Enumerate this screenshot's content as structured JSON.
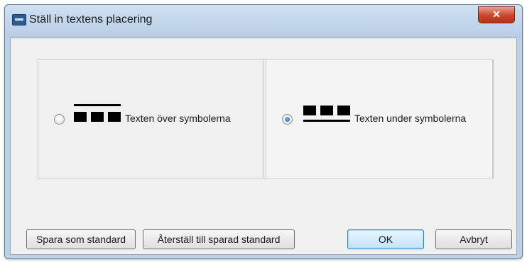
{
  "window": {
    "title": "Ställ in textens placering",
    "close_label": "✕"
  },
  "options": [
    {
      "label": "Texten över symbolerna",
      "selected": false
    },
    {
      "label": "Texten under symbolerna",
      "selected": true
    }
  ],
  "buttons": {
    "save_default": "Spara som standard",
    "restore_default": "Återställ till sparad standard",
    "ok": "OK",
    "cancel": "Avbryt"
  },
  "colors": {
    "accent": "#1a5fb4",
    "close": "#c9442a"
  }
}
